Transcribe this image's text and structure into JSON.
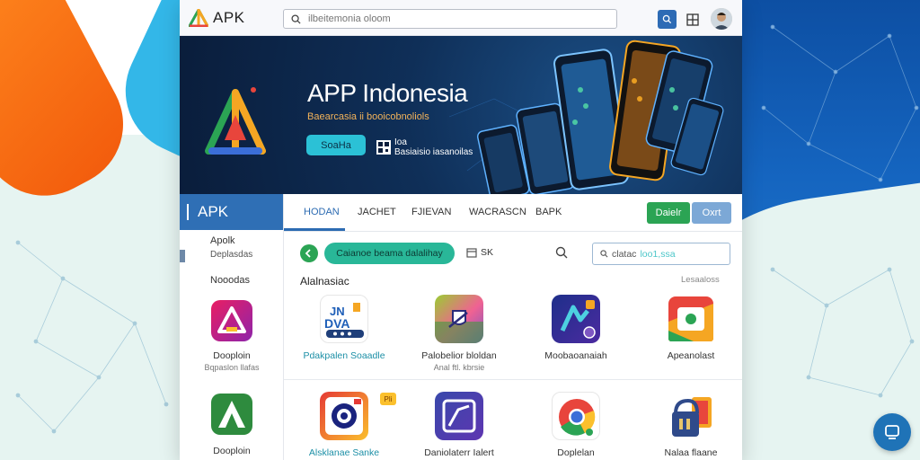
{
  "header": {
    "logo_text": "APK",
    "search_placeholder": "ilbeitemonia oloom"
  },
  "banner": {
    "title": "APP Indonesia",
    "subtitle": "Baearcasia ii booicobnoliols",
    "button_label": "SoaHa",
    "qr_label_top": "Ioa",
    "qr_label_bottom": "Basiaisio iasanoilas"
  },
  "sidebar": {
    "header": "APK",
    "items": [
      "Apolk",
      "Deplasdas",
      "Nooodas"
    ]
  },
  "tabs": [
    "HODAN",
    "JACHET",
    "FJIEVAN",
    "WACRASCN",
    "BAPK"
  ],
  "actions": {
    "green_button": "Daielr",
    "blue_button": "Oxrt"
  },
  "filter": {
    "pill_label": "Caianoe beama dalalihay",
    "sort_label": "SK",
    "search_text": "clatac",
    "search_highlight": "loo1,ssa"
  },
  "section": {
    "title": "Alalnasiac",
    "link": "Lesaaloss"
  },
  "apps_row1": [
    {
      "name": "Pdakpalen Soaadle",
      "sub": ""
    },
    {
      "name": "Palobelior bloldan",
      "sub": "Anal ftl. kbrsie"
    },
    {
      "name": "Moobaoanaiah",
      "sub": ""
    },
    {
      "name": "Apeanolast",
      "sub": ""
    }
  ],
  "apps_row2": [
    {
      "name": "Alsklanae Sanke",
      "sub": ""
    },
    {
      "name": "Daniolaterr Ialert",
      "sub": ""
    },
    {
      "name": "Doplelan",
      "sub": ""
    },
    {
      "name": "Nalaa flaane",
      "sub": ""
    }
  ],
  "sidebar_apps": [
    {
      "name": "Dooploin",
      "sub": "Bqpaslon llafas"
    },
    {
      "name": "Dooploin",
      "sub": ""
    }
  ],
  "app_badge": "Pli",
  "colors": {
    "brand_blue": "#2f6fb5",
    "accent_green": "#2ba454",
    "accent_teal": "#29b798"
  }
}
